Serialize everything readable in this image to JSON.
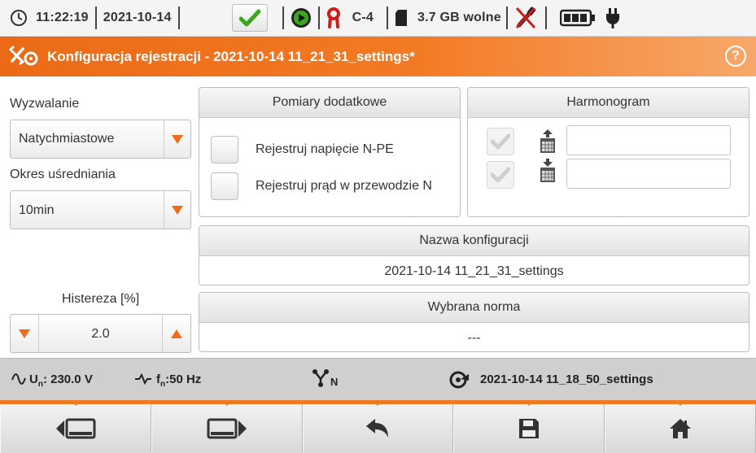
{
  "statusbar": {
    "time": "11:22:19",
    "date": "2021-10-14",
    "network_config": "C-4",
    "storage": "3.7 GB wolne",
    "icons": [
      "clock-icon",
      "checkmark-icon",
      "play-icon",
      "clamp-icon",
      "sd-card-icon",
      "usb-disconnected-icon",
      "battery-icon",
      "power-plug-icon"
    ]
  },
  "titlebar": {
    "title": "Konfiguracja rejestracji - 2021-10-14 11_21_31_settings*",
    "help_label": "?"
  },
  "left": {
    "trigger_label": "Wyzwalanie",
    "trigger_value": "Natychmiastowe",
    "averaging_label": "Okres uśredniania",
    "averaging_value": "10min",
    "hysteresis_label": "Histereza [%]",
    "hysteresis_value": "2.0"
  },
  "additional": {
    "title": "Pomiary dodatkowe",
    "opt1": "Rejestruj napięcie N-PE",
    "opt2": "Rejestruj prąd w przewodzie N"
  },
  "schedule": {
    "title": "Harmonogram"
  },
  "config_name": {
    "title": "Nazwa konfiguracji",
    "value": "2021-10-14 11_21_31_settings"
  },
  "norm": {
    "title": "Wybrana norma",
    "value": "---"
  },
  "infobar": {
    "un_label": "U",
    "un_sub": "n",
    "un_value": ": 230.0 V",
    "fn_label": "f",
    "fn_sub": "n",
    "fn_value": ":50 Hz",
    "network_sub": "N",
    "settings_file": "2021-10-14 11_18_50_settings"
  },
  "colors": {
    "accent": "#f07a22",
    "titlebar_start": "#ec6a16",
    "check_green": "#3aa71c"
  }
}
